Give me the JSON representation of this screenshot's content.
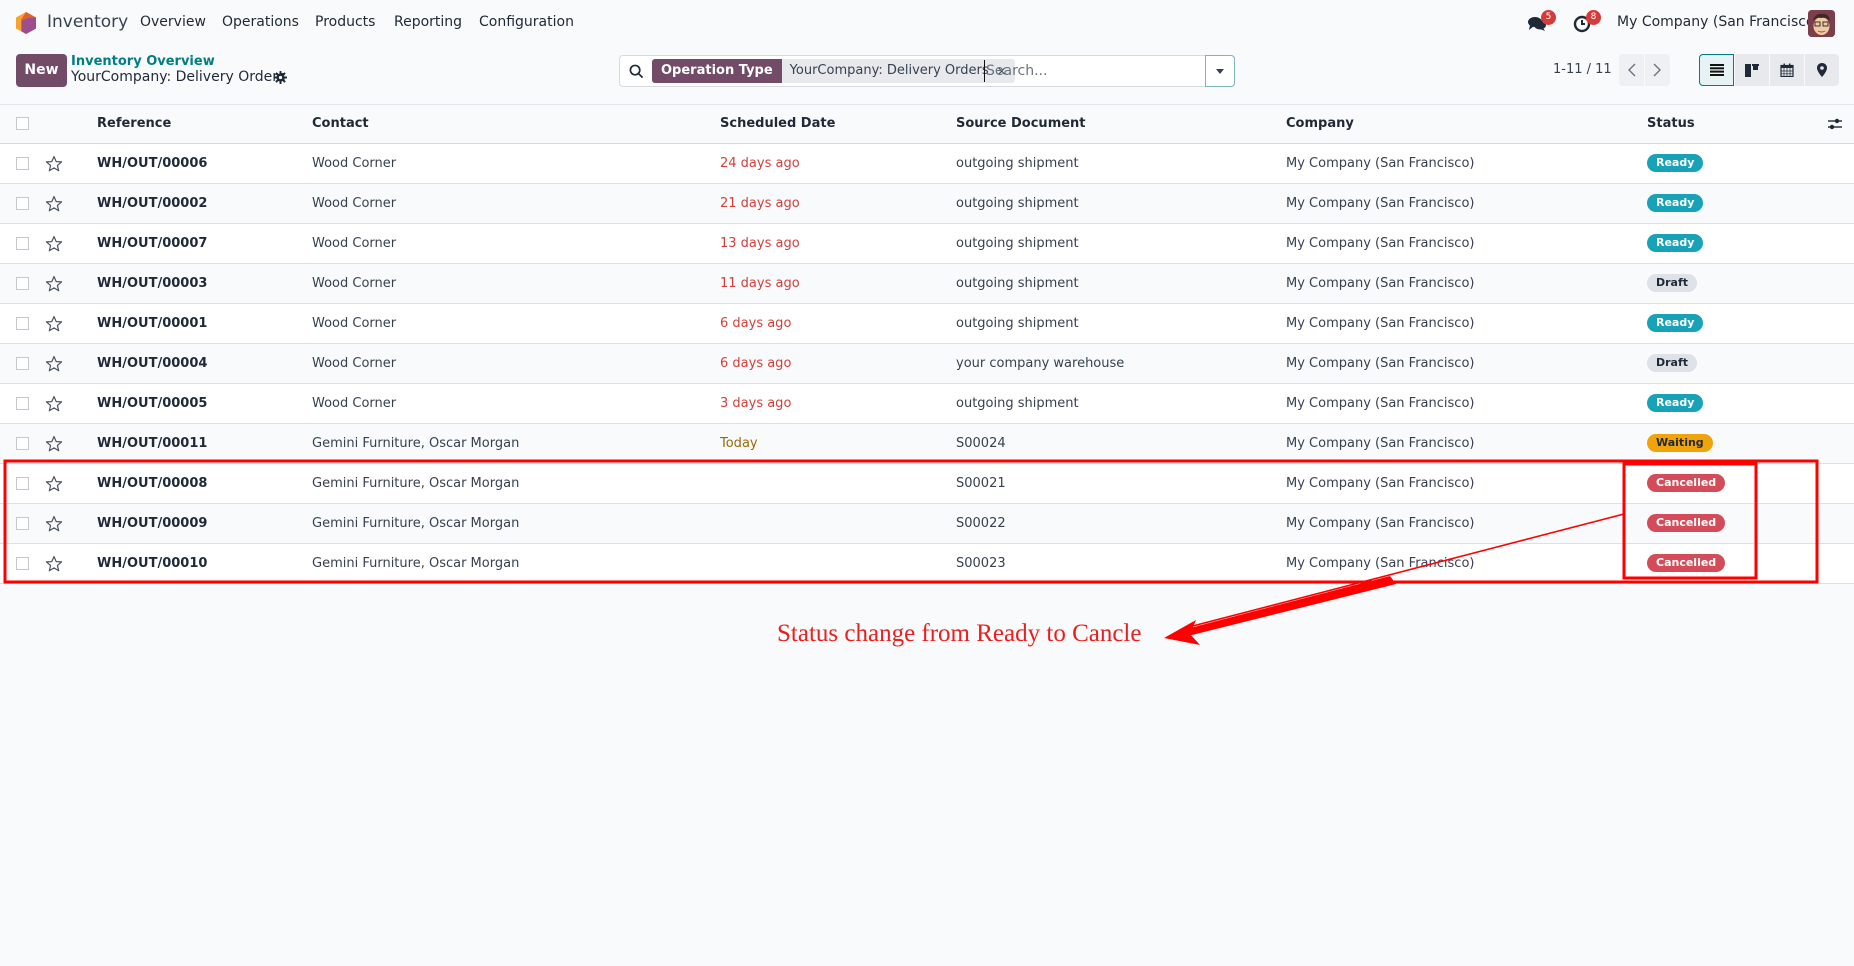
{
  "navbar": {
    "app_name": "Inventory",
    "menu": [
      "Overview",
      "Operations",
      "Products",
      "Reporting",
      "Configuration"
    ],
    "messages_count": "5",
    "activities_count": "8",
    "company": "My Company (San Francisco)"
  },
  "control_panel": {
    "new_label": "New",
    "breadcrumb_parent": "Inventory Overview",
    "breadcrumb_current": "YourCompany: Delivery Orders",
    "search": {
      "facet_label": "Operation Type",
      "facet_value": "YourCompany: Delivery Orders",
      "facet_close": "×",
      "placeholder": "Search..."
    },
    "pager": "1-11 / 11",
    "views": [
      "list",
      "kanban",
      "calendar",
      "map"
    ],
    "active_view": "list"
  },
  "table": {
    "columns": [
      "Reference",
      "Contact",
      "Scheduled Date",
      "Source Document",
      "Company",
      "Status"
    ],
    "rows": [
      {
        "reference": "WH/OUT/00006",
        "contact": "Wood Corner",
        "scheduled": "24 days ago",
        "date_state": "late",
        "source": "outgoing shipment",
        "company": "My Company (San Francisco)",
        "status": "Ready",
        "status_key": "ready"
      },
      {
        "reference": "WH/OUT/00002",
        "contact": "Wood Corner",
        "scheduled": "21 days ago",
        "date_state": "late",
        "source": "outgoing shipment",
        "company": "My Company (San Francisco)",
        "status": "Ready",
        "status_key": "ready"
      },
      {
        "reference": "WH/OUT/00007",
        "contact": "Wood Corner",
        "scheduled": "13 days ago",
        "date_state": "late",
        "source": "outgoing shipment",
        "company": "My Company (San Francisco)",
        "status": "Ready",
        "status_key": "ready"
      },
      {
        "reference": "WH/OUT/00003",
        "contact": "Wood Corner",
        "scheduled": "11 days ago",
        "date_state": "late",
        "source": "outgoing shipment",
        "company": "My Company (San Francisco)",
        "status": "Draft",
        "status_key": "draft"
      },
      {
        "reference": "WH/OUT/00001",
        "contact": "Wood Corner",
        "scheduled": "6 days ago",
        "date_state": "late",
        "source": "outgoing shipment",
        "company": "My Company (San Francisco)",
        "status": "Ready",
        "status_key": "ready"
      },
      {
        "reference": "WH/OUT/00004",
        "contact": "Wood Corner",
        "scheduled": "6 days ago",
        "date_state": "late",
        "source": "your company warehouse",
        "company": "My Company (San Francisco)",
        "status": "Draft",
        "status_key": "draft"
      },
      {
        "reference": "WH/OUT/00005",
        "contact": "Wood Corner",
        "scheduled": "3 days ago",
        "date_state": "late",
        "source": "outgoing shipment",
        "company": "My Company (San Francisco)",
        "status": "Ready",
        "status_key": "ready"
      },
      {
        "reference": "WH/OUT/00011",
        "contact": "Gemini Furniture, Oscar Morgan",
        "scheduled": "Today",
        "date_state": "today",
        "source": "S00024",
        "company": "My Company (San Francisco)",
        "status": "Waiting",
        "status_key": "waiting"
      },
      {
        "reference": "WH/OUT/00008",
        "contact": "Gemini Furniture, Oscar Morgan",
        "scheduled": "",
        "date_state": "none",
        "source": "S00021",
        "company": "My Company (San Francisco)",
        "status": "Cancelled",
        "status_key": "cancel"
      },
      {
        "reference": "WH/OUT/00009",
        "contact": "Gemini Furniture, Oscar Morgan",
        "scheduled": "",
        "date_state": "none",
        "source": "S00022",
        "company": "My Company (San Francisco)",
        "status": "Cancelled",
        "status_key": "cancel"
      },
      {
        "reference": "WH/OUT/00010",
        "contact": "Gemini Furniture, Oscar Morgan",
        "scheduled": "",
        "date_state": "none",
        "source": "S00023",
        "company": "My Company (San Francisco)",
        "status": "Cancelled",
        "status_key": "cancel"
      }
    ]
  },
  "annotation": {
    "text": "Status change from Ready to Cancle",
    "color": "#e8201f"
  }
}
